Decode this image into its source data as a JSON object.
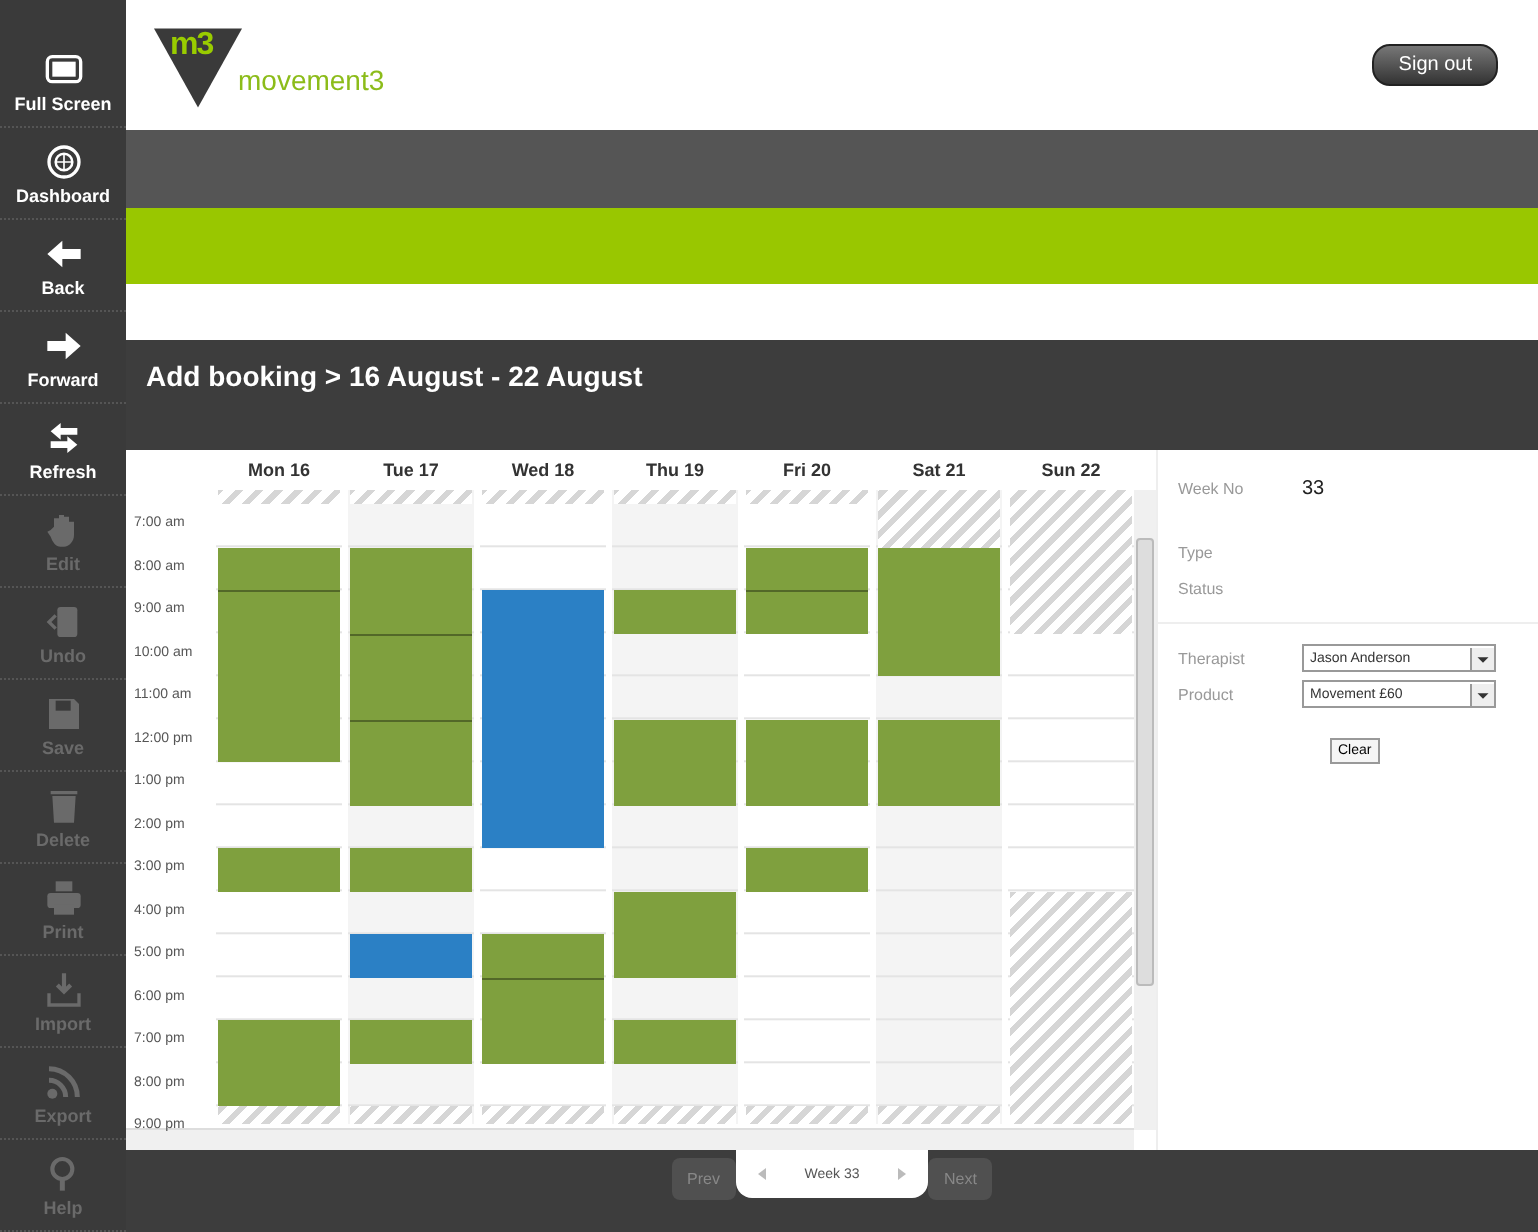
{
  "sidebar": {
    "items": [
      {
        "kind": "screen",
        "label": "Full Screen",
        "disabled": false
      },
      {
        "kind": "globe",
        "label": "Dashboard",
        "disabled": false
      },
      {
        "kind": "left",
        "label": "Back",
        "disabled": false
      },
      {
        "kind": "right",
        "label": "Forward",
        "disabled": false
      },
      {
        "kind": "swap",
        "label": "Refresh",
        "disabled": false
      },
      {
        "kind": "hand",
        "label": "Edit",
        "disabled": true
      },
      {
        "kind": "undo",
        "label": "Undo",
        "disabled": true
      },
      {
        "kind": "disk",
        "label": "Save",
        "disabled": true
      },
      {
        "kind": "bin",
        "label": "Delete",
        "disabled": true
      },
      {
        "kind": "printer",
        "label": "Print",
        "disabled": true
      },
      {
        "kind": "tray",
        "label": "Import",
        "disabled": true
      },
      {
        "kind": "feed",
        "label": "Export",
        "disabled": true
      },
      {
        "kind": "magnifier",
        "label": "Help",
        "disabled": true
      }
    ]
  },
  "header": {
    "logo_mark": "m3",
    "logo_text": "movement3",
    "sign_out": "Sign out"
  },
  "page_title": "Add booking > 16 August - 22 August",
  "calendar": {
    "times": [
      "7:00 am",
      "8:00 am",
      "9:00 am",
      "10:00 am",
      "11:00 am",
      "12:00 pm",
      "1:00 pm",
      "2:00 pm",
      "3:00 pm",
      "4:00 pm",
      "5:00 pm",
      "6:00 pm",
      "7:00 pm",
      "8:00 pm",
      "9:00 pm"
    ],
    "days": [
      {
        "label": "Mon 16",
        "slots": [
          {
            "kind": "unavailable"
          },
          {
            "kind": "free"
          },
          {
            "kind": "booking",
            "color": "#7fa03e"
          },
          {
            "kind": "booking",
            "color": "#7fa03e",
            "joined": false
          },
          {
            "kind": "booking",
            "color": "#7fa03e",
            "joined": true
          },
          {
            "kind": "booking",
            "color": "#7fa03e",
            "joined": true
          },
          {
            "kind": "booking",
            "color": "#7fa03e",
            "joined": true
          },
          {
            "kind": "free"
          },
          {
            "kind": "free"
          },
          {
            "kind": "booking",
            "color": "#7fa03e"
          },
          {
            "kind": "free"
          },
          {
            "kind": "free"
          },
          {
            "kind": "free"
          },
          {
            "kind": "booking",
            "color": "#7fa03e"
          },
          {
            "kind": "booking",
            "color": "#7fa03e",
            "joined": true
          },
          {
            "kind": "unavailable"
          }
        ]
      },
      {
        "label": "Tue 17",
        "slots": [
          {
            "kind": "unavailable"
          },
          {
            "kind": "free"
          },
          {
            "kind": "booking",
            "color": "#7fa03e"
          },
          {
            "kind": "booking",
            "color": "#7fa03e",
            "joined": true
          },
          {
            "kind": "booking",
            "color": "#7fa03e",
            "joined": false
          },
          {
            "kind": "booking",
            "color": "#7fa03e",
            "joined": true
          },
          {
            "kind": "booking",
            "color": "#7fa03e",
            "joined": false
          },
          {
            "kind": "booking",
            "color": "#7fa03e",
            "joined": true
          },
          {
            "kind": "free"
          },
          {
            "kind": "booking",
            "color": "#7fa03e"
          },
          {
            "kind": "free"
          },
          {
            "kind": "booking",
            "color": "#2b80c5"
          },
          {
            "kind": "free"
          },
          {
            "kind": "booking",
            "color": "#7fa03e"
          },
          {
            "kind": "free"
          },
          {
            "kind": "unavailable"
          }
        ]
      },
      {
        "label": "Wed 18",
        "slots": [
          {
            "kind": "unavailable"
          },
          {
            "kind": "free"
          },
          {
            "kind": "free"
          },
          {
            "kind": "booking",
            "color": "#2b80c5"
          },
          {
            "kind": "booking",
            "color": "#2b80c5",
            "joined": true
          },
          {
            "kind": "booking",
            "color": "#2b80c5",
            "joined": true
          },
          {
            "kind": "booking",
            "color": "#2b80c5",
            "joined": true
          },
          {
            "kind": "booking",
            "color": "#2b80c5",
            "joined": true
          },
          {
            "kind": "booking",
            "color": "#2b80c5",
            "joined": true
          },
          {
            "kind": "free"
          },
          {
            "kind": "free"
          },
          {
            "kind": "booking",
            "color": "#7fa03e"
          },
          {
            "kind": "booking",
            "color": "#7fa03e",
            "joined": false
          },
          {
            "kind": "booking",
            "color": "#7fa03e",
            "joined": true
          },
          {
            "kind": "free"
          },
          {
            "kind": "unavailable"
          }
        ]
      },
      {
        "label": "Thu 19",
        "slots": [
          {
            "kind": "unavailable"
          },
          {
            "kind": "free"
          },
          {
            "kind": "free"
          },
          {
            "kind": "booking",
            "color": "#7fa03e"
          },
          {
            "kind": "free"
          },
          {
            "kind": "free"
          },
          {
            "kind": "booking",
            "color": "#7fa03e"
          },
          {
            "kind": "booking",
            "color": "#7fa03e",
            "joined": true
          },
          {
            "kind": "free"
          },
          {
            "kind": "free"
          },
          {
            "kind": "booking",
            "color": "#7fa03e"
          },
          {
            "kind": "booking",
            "color": "#7fa03e",
            "joined": true
          },
          {
            "kind": "free"
          },
          {
            "kind": "booking",
            "color": "#7fa03e"
          },
          {
            "kind": "free"
          },
          {
            "kind": "unavailable"
          }
        ]
      },
      {
        "label": "Fri 20",
        "slots": [
          {
            "kind": "unavailable"
          },
          {
            "kind": "free"
          },
          {
            "kind": "booking",
            "color": "#7fa03e"
          },
          {
            "kind": "booking",
            "color": "#7fa03e",
            "joined": false
          },
          {
            "kind": "free"
          },
          {
            "kind": "free"
          },
          {
            "kind": "booking",
            "color": "#7fa03e"
          },
          {
            "kind": "booking",
            "color": "#7fa03e",
            "joined": true
          },
          {
            "kind": "free"
          },
          {
            "kind": "booking",
            "color": "#7fa03e"
          },
          {
            "kind": "free"
          },
          {
            "kind": "free"
          },
          {
            "kind": "free"
          },
          {
            "kind": "free"
          },
          {
            "kind": "free"
          },
          {
            "kind": "unavailable"
          }
        ]
      },
      {
        "label": "Sat 21",
        "slots": [
          {
            "kind": "unavailable"
          },
          {
            "kind": "unavailable"
          },
          {
            "kind": "booking",
            "color": "#7fa03e"
          },
          {
            "kind": "booking",
            "color": "#7fa03e",
            "joined": true
          },
          {
            "kind": "booking",
            "color": "#7fa03e",
            "joined": true
          },
          {
            "kind": "free"
          },
          {
            "kind": "booking",
            "color": "#7fa03e"
          },
          {
            "kind": "booking",
            "color": "#7fa03e",
            "joined": true
          },
          {
            "kind": "free"
          },
          {
            "kind": "free"
          },
          {
            "kind": "free"
          },
          {
            "kind": "free"
          },
          {
            "kind": "free"
          },
          {
            "kind": "free"
          },
          {
            "kind": "free"
          },
          {
            "kind": "unavailable"
          }
        ]
      },
      {
        "label": "Sun 22",
        "slots": [
          {
            "kind": "unavailable"
          },
          {
            "kind": "unavailable"
          },
          {
            "kind": "unavailable"
          },
          {
            "kind": "unavailable"
          },
          {
            "kind": "free"
          },
          {
            "kind": "free"
          },
          {
            "kind": "free"
          },
          {
            "kind": "free"
          },
          {
            "kind": "free"
          },
          {
            "kind": "free"
          },
          {
            "kind": "unavailable"
          },
          {
            "kind": "unavailable"
          },
          {
            "kind": "unavailable"
          },
          {
            "kind": "unavailable"
          },
          {
            "kind": "unavailable"
          },
          {
            "kind": "unavailable"
          }
        ]
      }
    ]
  },
  "details": {
    "week_no_label": "Week No",
    "week_no": "33",
    "type_label": "Type",
    "status_label": "Status",
    "therapist_label": "Therapist",
    "therapist": "Jason Anderson",
    "product_label": "Product",
    "product": "Movement £60",
    "clear": "Clear"
  },
  "pager": {
    "prev": "Prev",
    "week": "Week 33",
    "next": "Next"
  }
}
